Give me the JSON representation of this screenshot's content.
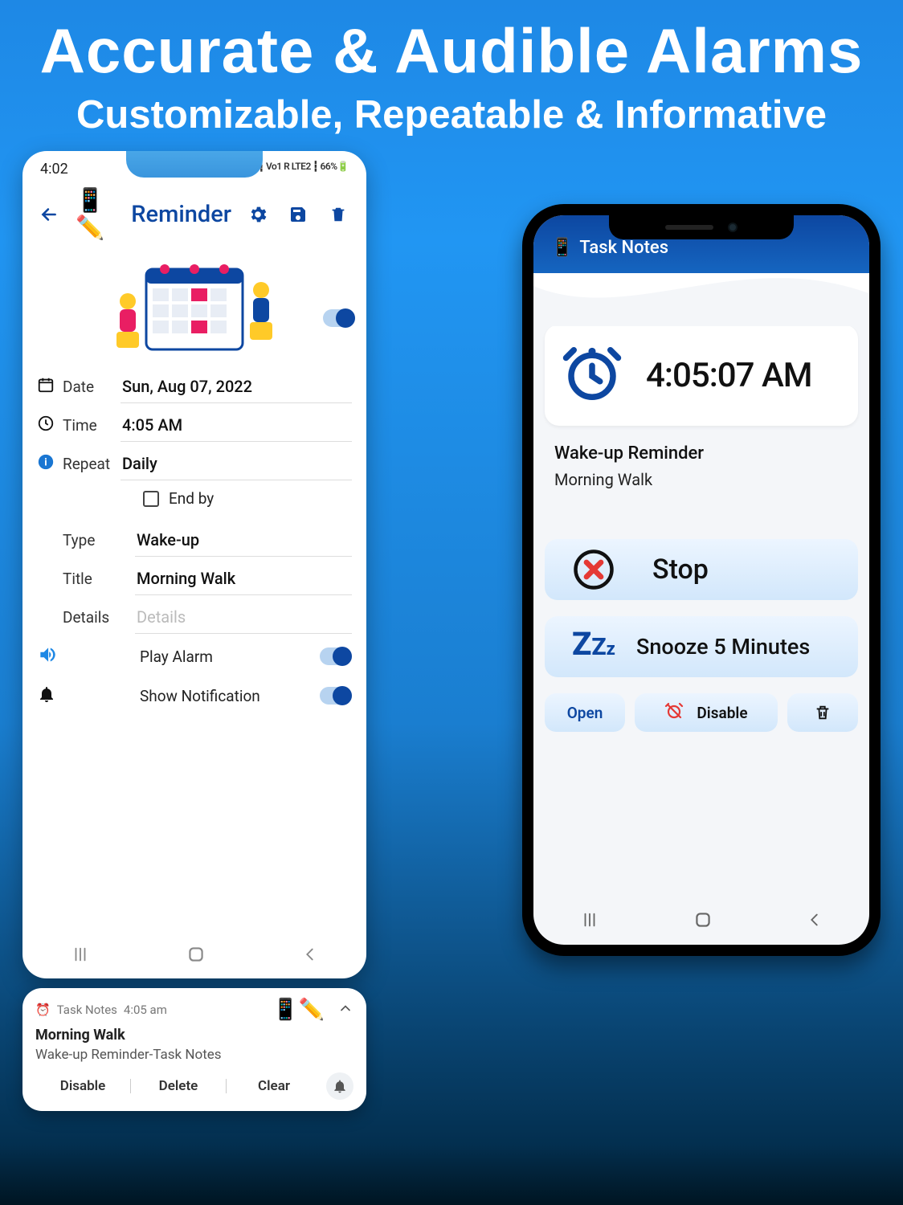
{
  "hero": {
    "line1": "Accurate & Audible Alarms",
    "line2": "Customizable, Repeatable & Informative"
  },
  "left": {
    "status": {
      "time": "4:02",
      "right": "Vo1 LTE1 ┇ Vo1 R LTE2 ┇ 66%🔋"
    },
    "header": {
      "title": "Reminder"
    },
    "form": {
      "date_label": "Date",
      "date_value": "Sun, Aug 07, 2022",
      "time_label": "Time",
      "time_value": "4:05 AM",
      "repeat_label": "Repeat",
      "repeat_value": "Daily",
      "endby_label": "End by",
      "type_label": "Type",
      "type_value": "Wake-up",
      "title_label": "Title",
      "title_value": "Morning Walk",
      "details_label": "Details",
      "details_ph": "Details",
      "play_label": "Play Alarm",
      "notif_label": "Show Notification"
    }
  },
  "notification": {
    "app": "Task Notes",
    "time": "4:05 am",
    "title": "Morning Walk",
    "desc": "Wake-up  Reminder-Task Notes",
    "actions": {
      "disable": "Disable",
      "delete": "Delete",
      "clear": "Clear"
    }
  },
  "right": {
    "app_title": "Task Notes",
    "alarm_time": "4:05:07 AM",
    "label1": "Wake-up Reminder",
    "label2": "Morning Walk",
    "stop": "Stop",
    "snooze": "Snooze 5 Minutes",
    "open": "Open",
    "disable": "Disable"
  }
}
